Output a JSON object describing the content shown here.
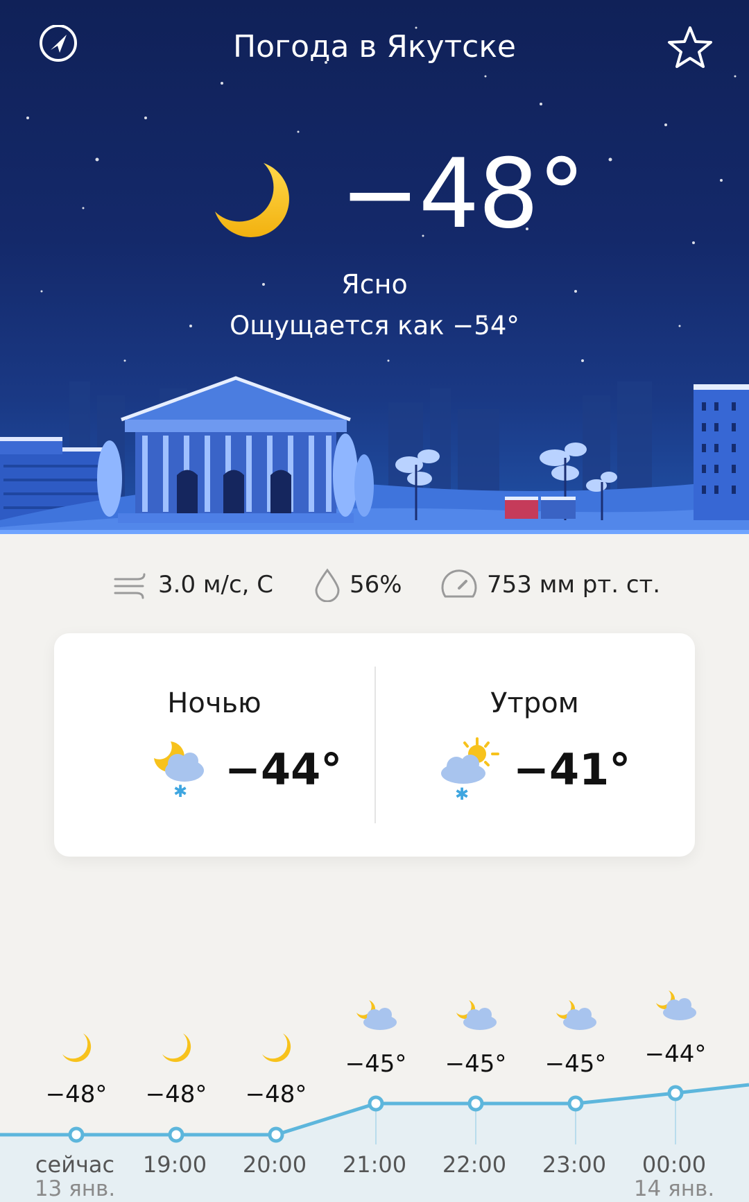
{
  "header": {
    "title": "Погода в Якутске",
    "location_icon": "location-arrow-icon",
    "favorite_icon": "star-icon"
  },
  "current": {
    "temperature": "−48°",
    "condition": "Ясно",
    "feels_like": "Ощущается как −54°",
    "icon": "moon-icon"
  },
  "metrics": {
    "wind": {
      "icon": "wind-icon",
      "value": "3.0 м/с, С"
    },
    "humidity": {
      "icon": "drop-icon",
      "value": "56%"
    },
    "pressure": {
      "icon": "gauge-icon",
      "value": "753 мм рт. ст."
    }
  },
  "day_parts": [
    {
      "label": "Ночью",
      "temp": "−44°",
      "icon": "moon-cloud-snow-icon"
    },
    {
      "label": "Утром",
      "temp": "−41°",
      "icon": "sun-cloud-snow-icon"
    }
  ],
  "hourly": [
    {
      "time": "сейчас",
      "date": "13 янв.",
      "temp": "−48°",
      "icon": "moon-icon"
    },
    {
      "time": "19:00",
      "temp": "−48°",
      "icon": "moon-icon"
    },
    {
      "time": "20:00",
      "temp": "−48°",
      "icon": "moon-icon"
    },
    {
      "time": "21:00",
      "temp": "−45°",
      "icon": "moon-cloud-icon"
    },
    {
      "time": "22:00",
      "temp": "−45°",
      "icon": "moon-cloud-icon"
    },
    {
      "time": "23:00",
      "temp": "−45°",
      "icon": "moon-cloud-icon"
    },
    {
      "time": "00:00",
      "date": "14 янв.",
      "temp": "−44°",
      "icon": "moon-cloud-icon"
    }
  ],
  "colors": {
    "accent_line": "#5db6dc",
    "sky_top": "#102158",
    "moon": "#f7c21c"
  }
}
